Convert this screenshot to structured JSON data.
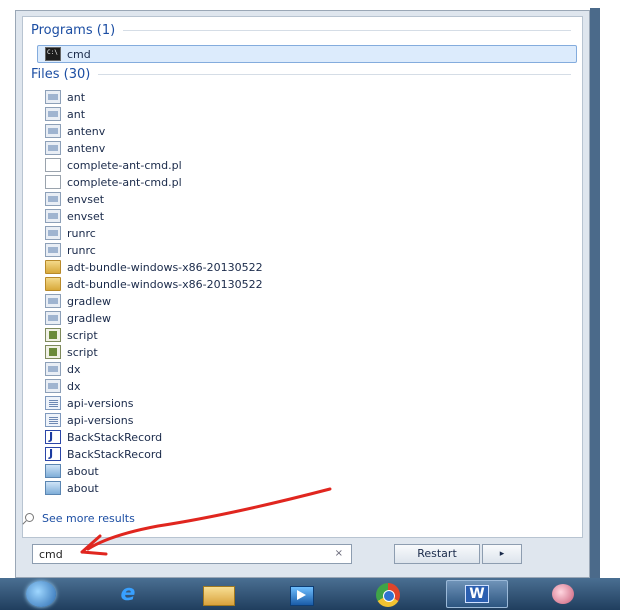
{
  "programs": {
    "header": "Programs (1)",
    "items": [
      {
        "label": "cmd",
        "icon": "cmd-icon"
      }
    ]
  },
  "files": {
    "header": "Files (30)",
    "items": [
      {
        "label": "ant",
        "icon": "batch-file-icon"
      },
      {
        "label": "ant",
        "icon": "batch-file-icon"
      },
      {
        "label": "antenv",
        "icon": "batch-file-icon"
      },
      {
        "label": "antenv",
        "icon": "batch-file-icon"
      },
      {
        "label": "complete-ant-cmd.pl",
        "icon": "blank-file-icon"
      },
      {
        "label": "complete-ant-cmd.pl",
        "icon": "blank-file-icon"
      },
      {
        "label": "envset",
        "icon": "batch-file-icon"
      },
      {
        "label": "envset",
        "icon": "batch-file-icon"
      },
      {
        "label": "runrc",
        "icon": "batch-file-icon"
      },
      {
        "label": "runrc",
        "icon": "batch-file-icon"
      },
      {
        "label": "adt-bundle-windows-x86-20130522",
        "icon": "folder-icon"
      },
      {
        "label": "adt-bundle-windows-x86-20130522",
        "icon": "folder-icon"
      },
      {
        "label": "gradlew",
        "icon": "batch-file-icon"
      },
      {
        "label": "gradlew",
        "icon": "batch-file-icon"
      },
      {
        "label": "script",
        "icon": "script-icon"
      },
      {
        "label": "script",
        "icon": "script-icon"
      },
      {
        "label": "dx",
        "icon": "batch-file-icon"
      },
      {
        "label": "dx",
        "icon": "batch-file-icon"
      },
      {
        "label": "api-versions",
        "icon": "document-icon"
      },
      {
        "label": "api-versions",
        "icon": "document-icon"
      },
      {
        "label": "BackStackRecord",
        "icon": "java-file-icon"
      },
      {
        "label": "BackStackRecord",
        "icon": "java-file-icon"
      },
      {
        "label": "about",
        "icon": "image-file-icon"
      },
      {
        "label": "about",
        "icon": "image-file-icon"
      }
    ]
  },
  "see_more": "See more results",
  "search": {
    "value": "cmd",
    "clear": "×"
  },
  "restart_label": "Restart",
  "restart_arrow": "▸",
  "taskbar": {
    "items": [
      "start-orb-icon",
      "internet-explorer-icon",
      "explorer-folder-icon",
      "media-player-icon",
      "chrome-icon",
      "word-icon",
      "paint-icon"
    ],
    "word_label": "W"
  },
  "annotation": {
    "color": "#e0261f"
  }
}
